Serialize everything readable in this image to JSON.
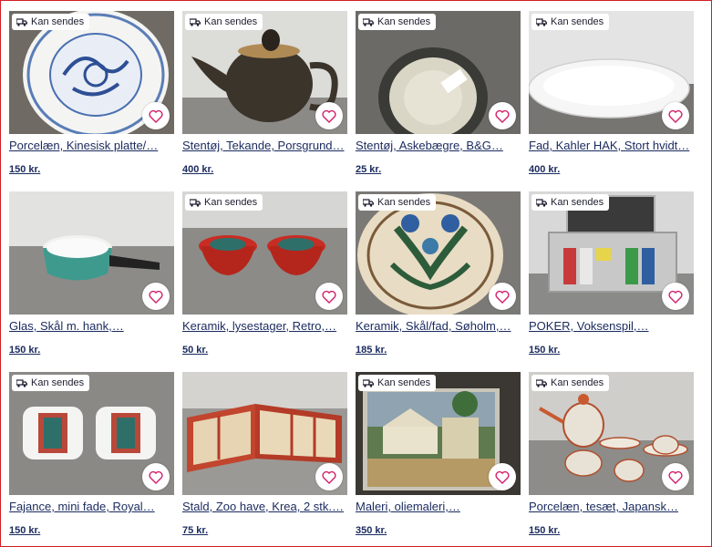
{
  "badge_text": "Kan sendes",
  "items": [
    {
      "title": "Porcelæn, Kinesisk platte/…",
      "price": "150 kr.",
      "image": "blue-white chinese dragon plate"
    },
    {
      "title": "Stentøj, Tekande, Porsgrund…",
      "price": "400 kr.",
      "image": "dark brown stoneware teapot"
    },
    {
      "title": "Stentøj, Askebægre, B&G…",
      "price": "25 kr.",
      "image": "ashtray seen from above"
    },
    {
      "title": "Fad, Kahler HAK, Stort hvidt…",
      "price": "400 kr.",
      "image": "large white oval dish"
    },
    {
      "title": "Glas, Skål m. hank,…",
      "price": "150 kr.",
      "image": "turquoise bowl with handle"
    },
    {
      "title": "Keramik, lysestager, Retro,…",
      "price": "50 kr.",
      "image": "two red ceramic candle holders"
    },
    {
      "title": "Keramik, Skål/fad, Søholm,…",
      "price": "185 kr.",
      "image": "decorated ceramic dish"
    },
    {
      "title": "POKER, Voksenspil,…",
      "price": "150 kr.",
      "image": "poker chip case"
    },
    {
      "title": "Fajance, mini fade, Royal…",
      "price": "150 kr.",
      "image": "two small faience dishes"
    },
    {
      "title": "Stald, Zoo have, Krea, 2 stk.…",
      "price": "75 kr.",
      "image": "toy stable zoo"
    },
    {
      "title": "Maleri, oliemaleri,…",
      "price": "350 kr.",
      "image": "oil painting of street scene"
    },
    {
      "title": "Porcelæn, tesæt, Japansk…",
      "price": "150 kr.",
      "image": "japanese tea set"
    }
  ],
  "colors": {
    "frame": "#d21f26",
    "link": "#1a2a5e"
  }
}
